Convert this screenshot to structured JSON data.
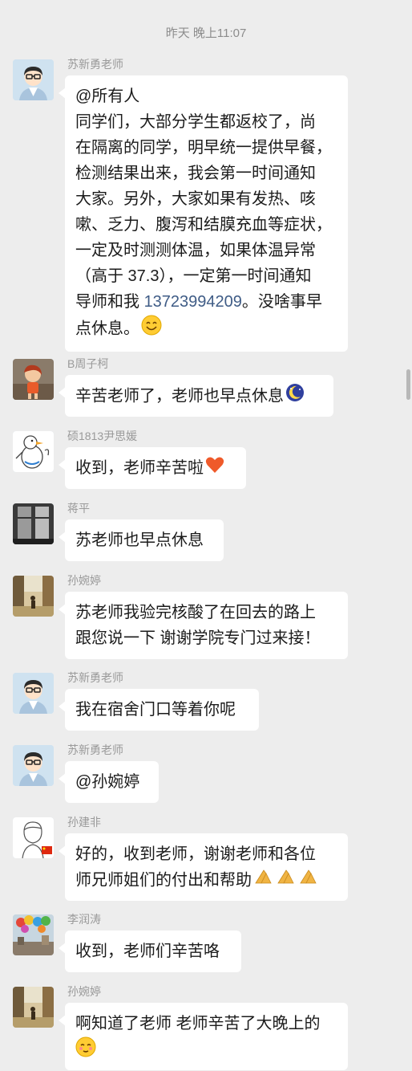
{
  "timestamp": "昨天 晚上11:07",
  "messages": [
    {
      "sender": "苏新勇老师",
      "avatar": "teacher-avatar",
      "lines": [
        "@所有人",
        "同学们，大部分学生都返校了，尚",
        "在隔离的同学，明早统一提供早餐，",
        "检测结果出来，我会第一时间通知",
        "大家。另外，大家如果有发热、咳",
        "嗽、乏力、腹泻和结膜充血等症状，",
        "一定及时测测体温，如果体温异常",
        "（高于 37.3），一定第一时间通知"
      ],
      "line_last_prefix": "导师和我 ",
      "phone": "13723994209",
      "line_last_suffix": "。没啥事早",
      "line_end": "点休息。",
      "emoji": "smile-emoji"
    },
    {
      "sender": "B周子柯",
      "avatar": "cartoon-girl-avatar",
      "text": "辛苦老师了，老师也早点休息",
      "emoji": "moon-emoji"
    },
    {
      "sender": "硕1813尹思媛",
      "avatar": "duck-avatar",
      "text": "收到，老师辛苦啦",
      "emoji": "heart-emoji"
    },
    {
      "sender": "蒋平",
      "avatar": "window-photo-avatar",
      "text": "苏老师也早点休息"
    },
    {
      "sender": "孙婉婷",
      "avatar": "street-photo-avatar",
      "lines": [
        "苏老师我验完核酸了在回去的路上",
        "跟您说一下 谢谢学院专门过来接！"
      ]
    },
    {
      "sender": "苏新勇老师",
      "avatar": "teacher-avatar",
      "text": "我在宿舍门口等着你呢"
    },
    {
      "sender": "苏新勇老师",
      "avatar": "teacher-avatar",
      "text": "@孙婉婷"
    },
    {
      "sender": "孙建非",
      "avatar": "sketch-avatar",
      "lines": [
        "好的，收到老师，谢谢老师和各位",
        "师兄师姐们的付出和帮助"
      ],
      "emoji": "pray-emoji"
    },
    {
      "sender": "李润涛",
      "avatar": "balloons-avatar",
      "text": "收到，老师们辛苦咯"
    },
    {
      "sender": "孙婉婷",
      "avatar": "street-photo-avatar",
      "lines": [
        "啊知道了老师 老师辛苦了大晚上的"
      ],
      "emoji": "blush-emoji"
    }
  ],
  "colors": {
    "background": "#ededed",
    "bubble": "#ffffff",
    "link": "#3f5c86",
    "sender": "#9a9a9a"
  }
}
